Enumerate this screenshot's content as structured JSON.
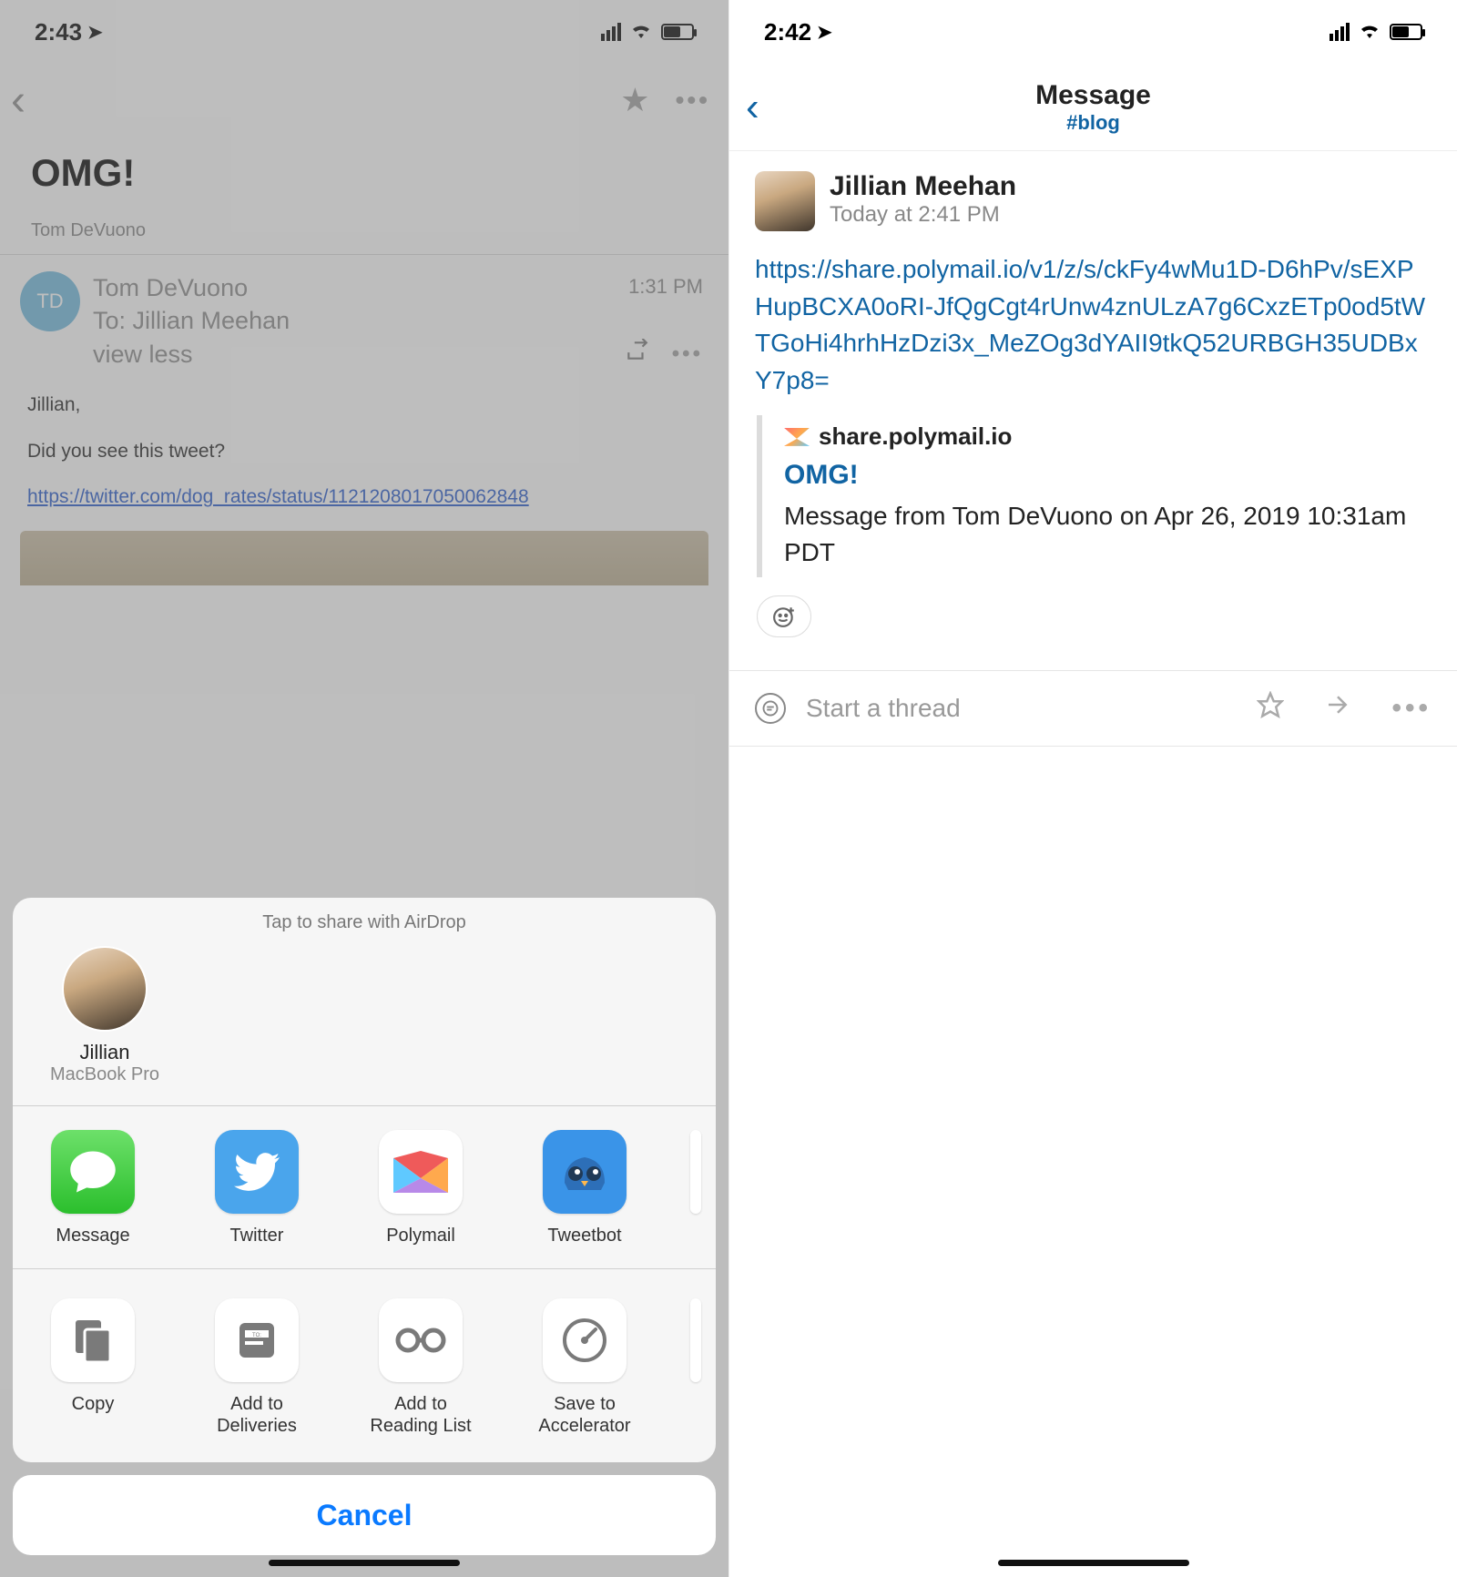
{
  "left": {
    "status": {
      "time": "2:43"
    },
    "email": {
      "subject": "OMG!",
      "thread_from_label": "Tom DeVuono",
      "avatar_initials": "TD",
      "from_name": "Tom DeVuono",
      "to_line": "To: Jillian Meehan",
      "view_less": "view less",
      "time": "1:31 PM",
      "greeting": "Jillian,",
      "body_line": "Did you see this tweet?",
      "tweet_link": "https://twitter.com/dog_rates/status/1121208017050062848"
    },
    "share": {
      "airdrop_hint": "Tap to share with AirDrop",
      "airdrop_name": "Jillian",
      "airdrop_device": "MacBook Pro",
      "apps": [
        {
          "label": "Message",
          "icon": "message"
        },
        {
          "label": "Twitter",
          "icon": "twitter"
        },
        {
          "label": "Polymail",
          "icon": "polymail"
        },
        {
          "label": "Tweetbot",
          "icon": "tweetbot"
        }
      ],
      "actions": [
        {
          "label": "Copy"
        },
        {
          "label": "Add to Deliveries"
        },
        {
          "label": "Add to Reading List"
        },
        {
          "label": "Save to Accelerator"
        }
      ],
      "cancel": "Cancel"
    }
  },
  "right": {
    "status": {
      "time": "2:42"
    },
    "header": {
      "title": "Message",
      "channel": "#blog"
    },
    "message": {
      "author": "Jillian Meehan",
      "timestamp": "Today at 2:41 PM",
      "link": "https://share.polymail.io/v1/z/s/ckFy4wMu1D-D6hPv/sEXPHupBCXA0oRI-JfQgCgt4rUnw4znULzA7g6CxzETp0od5tWTGoHi4hrhHzDzi3x_MeZOg3dYAII9tkQ52URBGH35UDBxY7p8=",
      "attachment": {
        "site": "share.polymail.io",
        "title": "OMG!",
        "desc": "Message from Tom DeVuono on Apr 26, 2019 10:31am PDT"
      }
    },
    "thread": {
      "placeholder": "Start a thread"
    }
  }
}
